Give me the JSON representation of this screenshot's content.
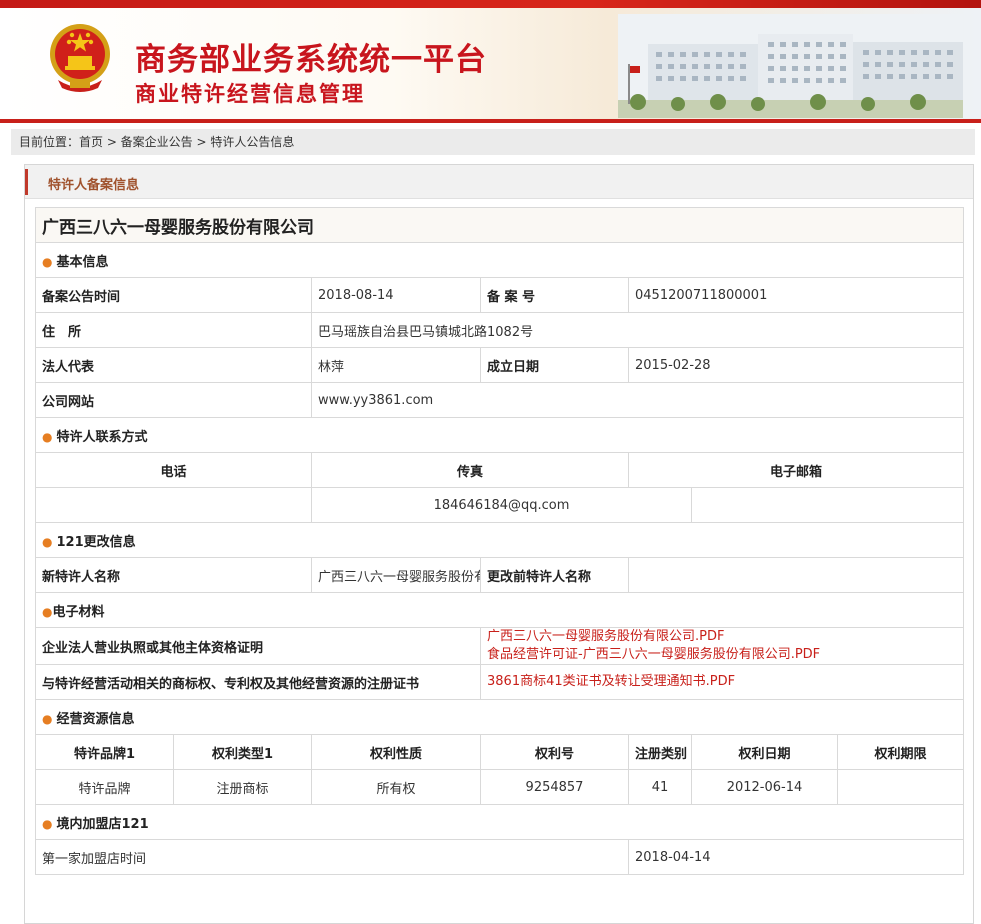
{
  "header": {
    "title_main": "商务部业务系统统一平台",
    "title_sub": "商业特许经营信息管理"
  },
  "breadcrumb": {
    "text": "目前位置：首页 > 备案企业公告 > 特许人公告信息"
  },
  "panel": {
    "title": "特许人备案信息"
  },
  "company": {
    "name": "广西三八六一母婴服务股份有限公司"
  },
  "basic": {
    "section": "基本信息",
    "filing_date_label": "备案公告时间",
    "filing_date": "2018-08-14",
    "record_no_label": "备 案 号",
    "record_no": "0451200711800001",
    "address_label": "住　所",
    "address": "巴马瑶族自治县巴马镇城北路1082号",
    "legal_rep_label": "法人代表",
    "legal_rep": "林萍",
    "founded_label": "成立日期",
    "founded": "2015-02-28",
    "website_label": "公司网站",
    "website": "www.yy3861.com"
  },
  "contact": {
    "section": "特许人联系方式",
    "phone_label": "电话",
    "fax_label": "传真",
    "email_label": "电子邮箱",
    "phone": "",
    "fax": "184646184@qq.com",
    "email": ""
  },
  "change": {
    "section": "121更改信息",
    "new_name_label": "新特许人名称",
    "new_name": "广西三八六一母婴服务股份有限公司",
    "old_name_label": "更改前特许人名称",
    "old_name": ""
  },
  "materials": {
    "section": "电子材料",
    "license_label": "企业法人营业执照或其他主体资格证明",
    "license_file_1": "广西三八六一母婴服务股份有限公司.PDF",
    "license_file_2": "食品经营许可证-广西三八六一母婴服务股份有限公司.PDF",
    "cert_label": "与特许经营活动相关的商标权、专利权及其他经营资源的注册证书",
    "cert_file_1": "3861商标41类证书及转让受理通知书.PDF"
  },
  "resources": {
    "section": "经营资源信息",
    "columns": [
      "特许品牌1",
      "权利类型1",
      "权利性质",
      "权利号",
      "注册类别",
      "权利日期",
      "权利期限"
    ],
    "row": [
      "特许品牌",
      "注册商标",
      "所有权",
      "9254857",
      "41",
      "2012-06-14",
      ""
    ]
  },
  "stores": {
    "section": "境内加盟店121",
    "first_store_label": "第一家加盟店时间",
    "first_store_date": "2018-04-14"
  }
}
